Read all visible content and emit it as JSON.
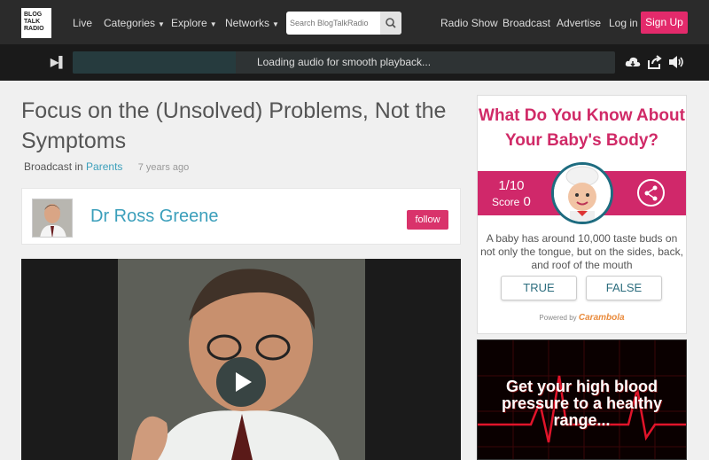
{
  "nav": {
    "logo": [
      "BLOG",
      "TALK",
      "RADIO"
    ],
    "live": "Live",
    "categories": "Categories",
    "explore": "Explore",
    "networks": "Networks",
    "search_placeholder": "Search BlogTalkRadio",
    "radio_show": "Radio Show",
    "broadcast": "Broadcast",
    "advertise": "Advertise",
    "login": "Log in",
    "signup": "Sign Up"
  },
  "player": {
    "status": "Loading audio for smooth playback...",
    "progress_pct": 30
  },
  "episode": {
    "title": "Focus on the (Unsolved) Problems, Not the Symptoms",
    "broadcast_in": "Broadcast in",
    "category": "Parents",
    "age": "7 years ago"
  },
  "host": {
    "name": "Dr Ross Greene",
    "follow": "follow"
  },
  "ad_quiz": {
    "title": "What Do You Know About Your Baby's Body?",
    "progress": "1/10",
    "score_label": "Score",
    "score": "0",
    "question": "A baby has around 10,000 taste buds on not only the tongue, but on the sides, back, and roof of the mouth",
    "true_label": "TRUE",
    "false_label": "FALSE",
    "powered_by": "Powered by",
    "brand": "Carambola"
  },
  "ad_bp": {
    "text": "Get your high blood pressure to a healthy range..."
  },
  "colors": {
    "accent_pink": "#e32a6b",
    "link_blue": "#3b9fbb"
  }
}
